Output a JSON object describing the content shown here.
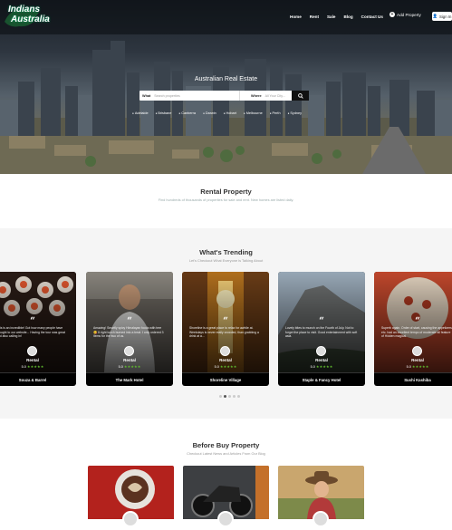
{
  "header": {
    "logo_line1": "Indians",
    "logo_line2": "Australia",
    "nav": [
      "Home",
      "Rent",
      "Sale",
      "Blog",
      "Contact Us"
    ],
    "add_property": "Add Property",
    "sign_in": "Sign In"
  },
  "hero": {
    "title": "Australian Real Estate",
    "search": {
      "what_label": "What",
      "what_placeholder": "Search properties",
      "where_label": "Where",
      "where_placeholder": "All Your City..."
    },
    "cities": [
      "Adelaide",
      "Brisbane",
      "Canberra",
      "Darwin",
      "Hobart",
      "Melbourne",
      "Perth",
      "Sydney"
    ]
  },
  "rental": {
    "title": "Rental Property",
    "subtitle": "Find hundreds of thousands of properties for sale and rent. New homes are listed daily."
  },
  "trending": {
    "title": "What's Trending",
    "subtitle": "Let's Checkout What Everyone is Talking About",
    "cards": [
      {
        "text": "This is an incredible! Got how many people have brought to our website... Having the tour was great and also calling in!",
        "type": "Rental",
        "rating": "5.0",
        "stars": "★★★★★",
        "name": "Souza & Barrel"
      },
      {
        "text": "Amazing! Smartly spicy Himalayan foods with tree 😋 It right lunch burned into a treat. I only ordered 3 items for the two of us.",
        "type": "Rental",
        "rating": "5.0",
        "stars": "★★★★★",
        "name": "The Mark Hotel"
      },
      {
        "text": "Shoreline is a great place to relax for awhile at. Weekdays is never really crowded, than grabbing a drink at a...",
        "type": "Rental",
        "rating": "5.0",
        "stars": "★★★★★",
        "name": "Shoreline Village"
      },
      {
        "text": "Lovely bites to munch on the Fourth of July. Not to forget the place to visit. Good entertainment with soft asia.",
        "type": "Rental",
        "rating": "5.0",
        "stars": "★★★★★",
        "name": "Staple & Fancy Hotel"
      },
      {
        "text": "Superb again. Order of start, causing the appetizers etc. had an excellent tempo of moderate all feature of Hidden magical.",
        "type": "Rental",
        "rating": "5.0",
        "stars": "★★★★★",
        "name": "Sushi Kashiba"
      }
    ]
  },
  "buy": {
    "title": "Before Buy Property",
    "subtitle": "Checkout Latest News and Articles From Our Blog"
  }
}
